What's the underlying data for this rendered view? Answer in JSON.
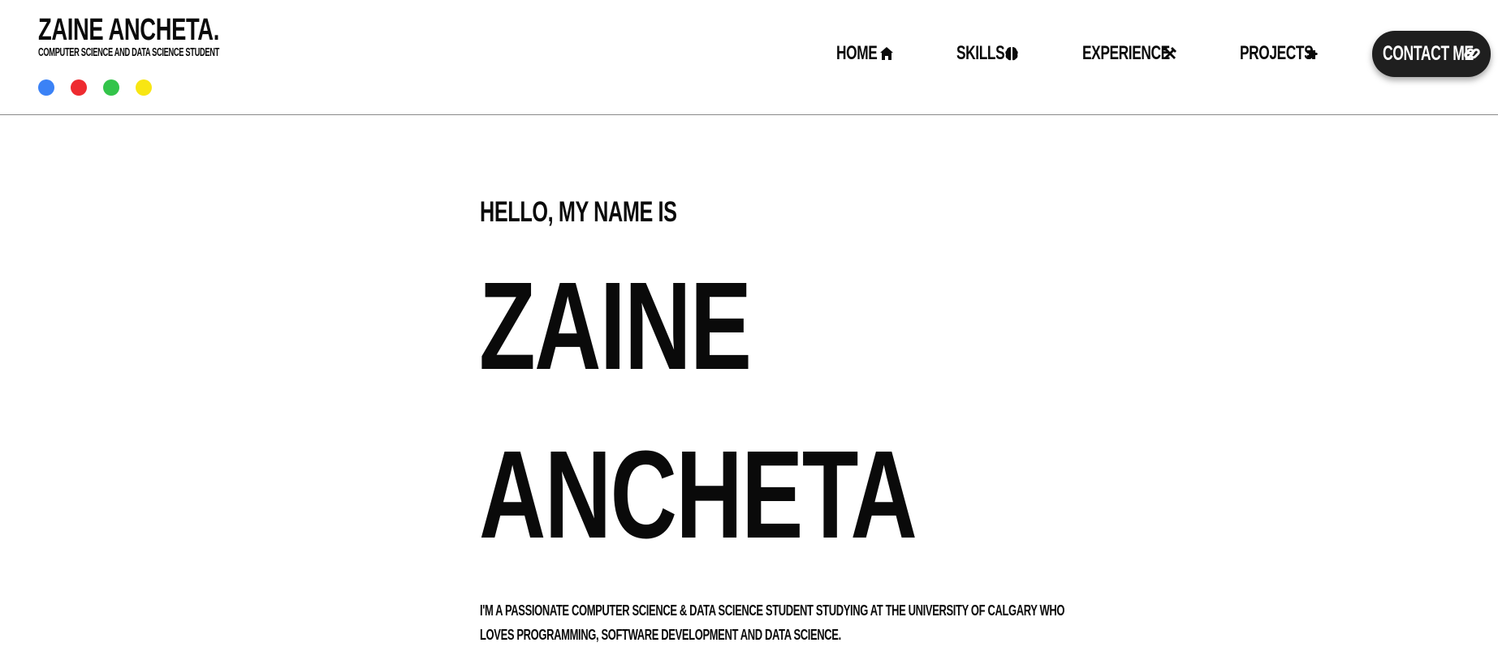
{
  "brand": {
    "title": "ZAINE ANCHETA.",
    "subtitle": "COMPUTER SCIENCE AND DATA SCIENCE STUDENT",
    "dots": [
      {
        "name": "blue-dot",
        "color": "#3b82f6"
      },
      {
        "name": "red-dot",
        "color": "#ee2b30"
      },
      {
        "name": "green-dot",
        "color": "#33c44a"
      },
      {
        "name": "yellow-dot",
        "color": "#f8e613"
      }
    ]
  },
  "nav": {
    "items": [
      {
        "label": "HOME",
        "icon": "home-icon"
      },
      {
        "label": "SKILLS",
        "icon": "brain-icon"
      },
      {
        "label": "EXPERIENCE",
        "icon": "tools-icon"
      },
      {
        "label": "PROJECTS",
        "icon": "puzzle-icon"
      }
    ],
    "contact": {
      "label": "CONTACT ME",
      "icon": "link-icon"
    }
  },
  "hero": {
    "greeting": "HELLO, MY NAME IS",
    "first_name": "ZAINE",
    "last_name": "ANCHETA",
    "bio": "I'M A PASSIONATE COMPUTER SCIENCE & DATA SCIENCE STUDENT STUDYING AT THE UNIVERSITY OF CALGARY WHO LOVES PROGRAMMING, SOFTWARE DEVELOPMENT AND DATA SCIENCE."
  },
  "colors": {
    "text": "#0a0a0a",
    "button_bg": "#1f1f1f",
    "divider": "#8a8a8a"
  }
}
